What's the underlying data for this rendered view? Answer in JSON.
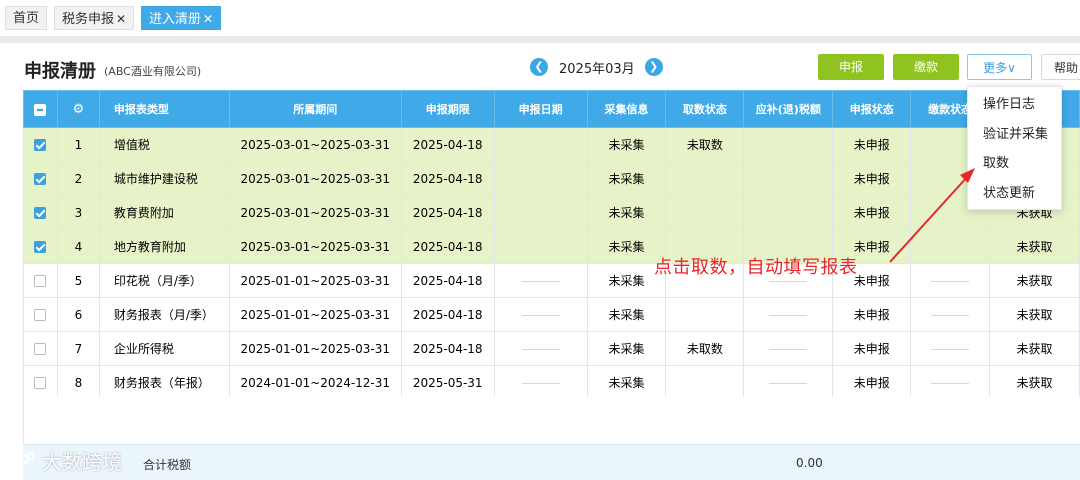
{
  "tabs": [
    {
      "label": "首页",
      "closable": false,
      "active": false
    },
    {
      "label": "税务申报",
      "closable": true,
      "active": false
    },
    {
      "label": "进入清册",
      "closable": true,
      "active": true
    }
  ],
  "page": {
    "title": "申报清册",
    "company": "(ABC酒业有限公司)",
    "month": "2025年03月"
  },
  "toolbar": {
    "declare": "申报",
    "pay": "缴款",
    "more": "更多∨",
    "help": "帮助"
  },
  "table": {
    "headers": [
      "",
      "⚙",
      "申报表类型",
      "所属期间",
      "申报期限",
      "申报日期",
      "采集信息",
      "取数状态",
      "应补(退)税额",
      "申报状态",
      "缴款状态",
      ""
    ],
    "rows": [
      {
        "checked": true,
        "no": "1",
        "type": "增值税",
        "period": "2025-03-01~2025-03-31",
        "deadline": "2025-04-18",
        "date": "",
        "collect": "未采集",
        "fetch": "未取数",
        "tax": "",
        "status": "未申报",
        "pay": ""
      },
      {
        "checked": true,
        "no": "2",
        "type": "城市维护建设税",
        "period": "2025-03-01~2025-03-31",
        "deadline": "2025-04-18",
        "date": "",
        "collect": "未采集",
        "fetch": "",
        "tax": "",
        "status": "未申报",
        "pay": ""
      },
      {
        "checked": true,
        "no": "3",
        "type": "教育费附加",
        "period": "2025-03-01~2025-03-31",
        "deadline": "2025-04-18",
        "date": "",
        "collect": "未采集",
        "fetch": "",
        "tax": "",
        "status": "未申报",
        "pay": "未获取"
      },
      {
        "checked": true,
        "no": "4",
        "type": "地方教育附加",
        "period": "2025-03-01~2025-03-31",
        "deadline": "2025-04-18",
        "date": "",
        "collect": "未采集",
        "fetch": "",
        "tax": "",
        "status": "未申报",
        "pay": "未获取"
      },
      {
        "checked": false,
        "no": "5",
        "type": "印花税（月/季）",
        "period": "2025-01-01~2025-03-31",
        "deadline": "2025-04-18",
        "date": "",
        "collect": "未采集",
        "fetch": "",
        "tax": "",
        "status": "未申报",
        "pay": "未获取"
      },
      {
        "checked": false,
        "no": "6",
        "type": "财务报表（月/季）",
        "period": "2025-01-01~2025-03-31",
        "deadline": "2025-04-18",
        "date": "",
        "collect": "未采集",
        "fetch": "",
        "tax": "",
        "status": "未申报",
        "pay": "未获取"
      },
      {
        "checked": false,
        "no": "7",
        "type": "企业所得税",
        "period": "2025-01-01~2025-03-31",
        "deadline": "2025-04-18",
        "date": "",
        "collect": "未采集",
        "fetch": "未取数",
        "tax": "",
        "status": "未申报",
        "pay": "未获取"
      },
      {
        "checked": false,
        "no": "8",
        "type": "财务报表（年报）",
        "period": "2024-01-01~2024-12-31",
        "deadline": "2025-05-31",
        "date": "",
        "collect": "未采集",
        "fetch": "",
        "tax": "",
        "status": "未申报",
        "pay": "未获取"
      }
    ]
  },
  "total": {
    "label": "合计税额",
    "value": "0.00"
  },
  "dropdown": [
    "操作日志",
    "验证并采集",
    "取数",
    "状态更新"
  ],
  "annotation": "点击取数，自动填写报表",
  "watermark": "大数跨境",
  "colors": {
    "header_blue": "#40a9e8",
    "accent_green": "#8fc31f",
    "selected_row": "#e6f3c8",
    "annotation_red": "#e8262a"
  }
}
